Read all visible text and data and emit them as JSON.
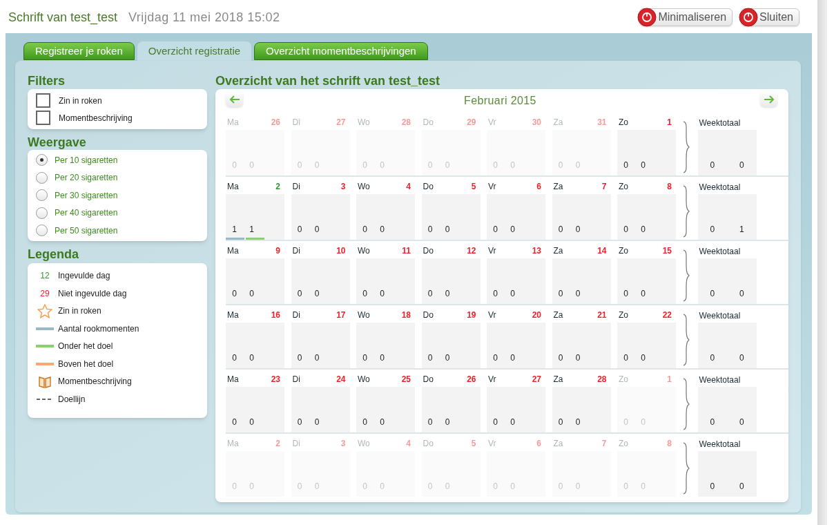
{
  "header": {
    "title": "Schrift van test_test",
    "datetime": "Vrijdag 11 mei 2018 15:02",
    "buttons": [
      "Minimaliseren",
      "Sluiten"
    ]
  },
  "tabs": [
    {
      "label": "Registreer je roken",
      "selected": false
    },
    {
      "label": "Overzicht registratie",
      "selected": true
    },
    {
      "label": "Overzicht momentbeschrijvingen",
      "selected": false
    }
  ],
  "filters": {
    "title": "Filters",
    "items": [
      {
        "label": "Zin in roken",
        "checked": false
      },
      {
        "label": "Momentbeschrijving",
        "checked": false
      }
    ]
  },
  "view": {
    "title": "Weergave",
    "options": [
      {
        "label": "Per 10 sigaretten",
        "selected": true
      },
      {
        "label": "Per 20 sigaretten",
        "selected": false
      },
      {
        "label": "Per 30 sigaretten",
        "selected": false
      },
      {
        "label": "Per 40 sigaretten",
        "selected": false
      },
      {
        "label": "Per 50 sigaretten",
        "selected": false
      }
    ]
  },
  "legend": {
    "title": "Legenda",
    "items": [
      {
        "kind": "number",
        "mark": "12",
        "filled": true,
        "label": "Ingevulde dag"
      },
      {
        "kind": "number",
        "mark": "29",
        "filled": false,
        "label": "Niet ingevulde dag"
      },
      {
        "kind": "star",
        "label": "Zin in roken"
      },
      {
        "kind": "line",
        "color": "#9bb8c6",
        "label": "Aantal rookmomenten"
      },
      {
        "kind": "line",
        "color": "#8ccf72",
        "label": "Onder het doel"
      },
      {
        "kind": "line",
        "color": "#f7a77c",
        "label": "Boven het doel"
      },
      {
        "kind": "book",
        "label": "Momentbeschrijving"
      },
      {
        "kind": "dash",
        "label": "Doellijn"
      }
    ]
  },
  "calendar": {
    "title": "Overzicht van het schrift van test_test",
    "month": "Februari 2015",
    "weeks": [
      {
        "days": [
          {
            "weekday": "Ma",
            "date": "26",
            "in_month": false,
            "filled": false,
            "values": [
              "0",
              "0"
            ]
          },
          {
            "weekday": "Di",
            "date": "27",
            "in_month": false,
            "filled": false,
            "values": [
              "0",
              "0"
            ]
          },
          {
            "weekday": "Wo",
            "date": "28",
            "in_month": false,
            "filled": false,
            "values": [
              "0",
              "0"
            ]
          },
          {
            "weekday": "Do",
            "date": "29",
            "in_month": false,
            "filled": false,
            "values": [
              "0",
              "0"
            ]
          },
          {
            "weekday": "Vr",
            "date": "30",
            "in_month": false,
            "filled": false,
            "values": [
              "0",
              "0"
            ]
          },
          {
            "weekday": "Za",
            "date": "31",
            "in_month": false,
            "filled": false,
            "values": [
              "0",
              "0"
            ]
          },
          {
            "weekday": "Zo",
            "date": "1",
            "in_month": true,
            "filled": false,
            "values": [
              "0",
              "0"
            ]
          }
        ],
        "total": {
          "label": "Weektotaal",
          "values": [
            "0",
            "0"
          ]
        }
      },
      {
        "days": [
          {
            "weekday": "Ma",
            "date": "2",
            "in_month": true,
            "filled": true,
            "values": [
              "1",
              "1"
            ],
            "bars": [
              {
                "color": "#9bb8c6"
              },
              {
                "color": "#8ccf72"
              }
            ]
          },
          {
            "weekday": "Di",
            "date": "3",
            "in_month": true,
            "filled": false,
            "values": [
              "0",
              "0"
            ]
          },
          {
            "weekday": "Wo",
            "date": "4",
            "in_month": true,
            "filled": false,
            "values": [
              "0",
              "0"
            ]
          },
          {
            "weekday": "Do",
            "date": "5",
            "in_month": true,
            "filled": false,
            "values": [
              "0",
              "0"
            ]
          },
          {
            "weekday": "Vr",
            "date": "6",
            "in_month": true,
            "filled": false,
            "values": [
              "0",
              "0"
            ]
          },
          {
            "weekday": "Za",
            "date": "7",
            "in_month": true,
            "filled": false,
            "values": [
              "0",
              "0"
            ]
          },
          {
            "weekday": "Zo",
            "date": "8",
            "in_month": true,
            "filled": false,
            "values": [
              "0",
              "0"
            ]
          }
        ],
        "total": {
          "label": "Weektotaal",
          "values": [
            "0",
            "1"
          ]
        }
      },
      {
        "days": [
          {
            "weekday": "Ma",
            "date": "9",
            "in_month": true,
            "filled": false,
            "values": [
              "0",
              "0"
            ]
          },
          {
            "weekday": "Di",
            "date": "10",
            "in_month": true,
            "filled": false,
            "values": [
              "0",
              "0"
            ]
          },
          {
            "weekday": "Wo",
            "date": "11",
            "in_month": true,
            "filled": false,
            "values": [
              "0",
              "0"
            ]
          },
          {
            "weekday": "Do",
            "date": "12",
            "in_month": true,
            "filled": false,
            "values": [
              "0",
              "0"
            ]
          },
          {
            "weekday": "Vr",
            "date": "13",
            "in_month": true,
            "filled": false,
            "values": [
              "0",
              "0"
            ]
          },
          {
            "weekday": "Za",
            "date": "14",
            "in_month": true,
            "filled": false,
            "values": [
              "0",
              "0"
            ]
          },
          {
            "weekday": "Zo",
            "date": "15",
            "in_month": true,
            "filled": false,
            "values": [
              "0",
              "0"
            ]
          }
        ],
        "total": {
          "label": "Weektotaal",
          "values": [
            "0",
            "0"
          ]
        }
      },
      {
        "days": [
          {
            "weekday": "Ma",
            "date": "16",
            "in_month": true,
            "filled": false,
            "values": [
              "0",
              "0"
            ]
          },
          {
            "weekday": "Di",
            "date": "17",
            "in_month": true,
            "filled": false,
            "values": [
              "0",
              "0"
            ]
          },
          {
            "weekday": "Wo",
            "date": "18",
            "in_month": true,
            "filled": false,
            "values": [
              "0",
              "0"
            ]
          },
          {
            "weekday": "Do",
            "date": "19",
            "in_month": true,
            "filled": false,
            "values": [
              "0",
              "0"
            ]
          },
          {
            "weekday": "Vr",
            "date": "20",
            "in_month": true,
            "filled": false,
            "values": [
              "0",
              "0"
            ]
          },
          {
            "weekday": "Za",
            "date": "21",
            "in_month": true,
            "filled": false,
            "values": [
              "0",
              "0"
            ]
          },
          {
            "weekday": "Zo",
            "date": "22",
            "in_month": true,
            "filled": false,
            "values": [
              "0",
              "0"
            ]
          }
        ],
        "total": {
          "label": "Weektotaal",
          "values": [
            "0",
            "0"
          ]
        }
      },
      {
        "days": [
          {
            "weekday": "Ma",
            "date": "23",
            "in_month": true,
            "filled": false,
            "values": [
              "0",
              "0"
            ]
          },
          {
            "weekday": "Di",
            "date": "24",
            "in_month": true,
            "filled": false,
            "values": [
              "0",
              "0"
            ]
          },
          {
            "weekday": "Wo",
            "date": "25",
            "in_month": true,
            "filled": false,
            "values": [
              "0",
              "0"
            ]
          },
          {
            "weekday": "Do",
            "date": "26",
            "in_month": true,
            "filled": false,
            "values": [
              "0",
              "0"
            ]
          },
          {
            "weekday": "Vr",
            "date": "27",
            "in_month": true,
            "filled": false,
            "values": [
              "0",
              "0"
            ]
          },
          {
            "weekday": "Za",
            "date": "28",
            "in_month": true,
            "filled": false,
            "values": [
              "0",
              "0"
            ]
          },
          {
            "weekday": "Zo",
            "date": "1",
            "in_month": false,
            "filled": false,
            "values": [
              "0",
              "0"
            ]
          }
        ],
        "total": {
          "label": "Weektotaal",
          "values": [
            "0",
            "0"
          ]
        }
      },
      {
        "days": [
          {
            "weekday": "Ma",
            "date": "2",
            "in_month": false,
            "filled": false,
            "values": [
              "0",
              "0"
            ]
          },
          {
            "weekday": "Di",
            "date": "3",
            "in_month": false,
            "filled": false,
            "values": [
              "0",
              "0"
            ]
          },
          {
            "weekday": "Wo",
            "date": "4",
            "in_month": false,
            "filled": false,
            "values": [
              "0",
              "0"
            ]
          },
          {
            "weekday": "Do",
            "date": "5",
            "in_month": false,
            "filled": false,
            "values": [
              "0",
              "0"
            ]
          },
          {
            "weekday": "Vr",
            "date": "6",
            "in_month": false,
            "filled": false,
            "values": [
              "0",
              "0"
            ]
          },
          {
            "weekday": "Za",
            "date": "7",
            "in_month": false,
            "filled": false,
            "values": [
              "0",
              "0"
            ]
          },
          {
            "weekday": "Zo",
            "date": "8",
            "in_month": false,
            "filled": false,
            "values": [
              "0",
              "0"
            ]
          }
        ],
        "total": {
          "label": "Weektotaal",
          "values": [
            "0",
            "0"
          ]
        }
      }
    ]
  }
}
